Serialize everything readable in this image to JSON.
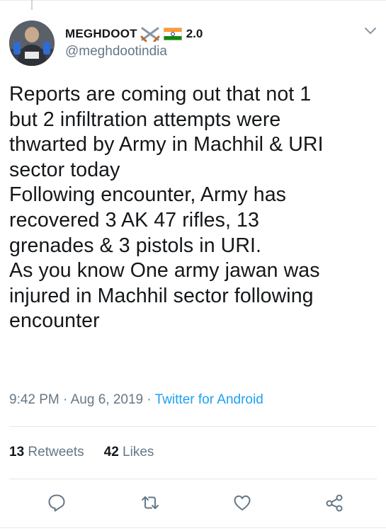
{
  "author": {
    "display_name": "MEGHDOOT",
    "name_suffix": "2.0",
    "handle": "@meghdootindia",
    "name_icons": [
      "crossed-swords-icon",
      "india-flag-icon"
    ]
  },
  "tweet": {
    "lines": [
      "Reports are coming out that not 1",
      "but 2 infiltration attempts were",
      "thwarted by Army in Machhil & URI",
      "sector today",
      "Following encounter, Army has",
      "recovered 3 AK 47 rifles, 13",
      "grenades & 3 pistols in URI.",
      "As you know One army jawan was",
      "injured in Machhil sector following",
      "encounter"
    ]
  },
  "meta": {
    "time": "9:42 PM",
    "separator": " · ",
    "date": "Aug 6, 2019",
    "source": "Twitter for Android"
  },
  "stats": {
    "retweets_count": "13",
    "retweets_label": " Retweets",
    "likes_count": "42",
    "likes_label": " Likes"
  },
  "actions": [
    "reply-icon",
    "retweet-icon",
    "like-icon",
    "share-icon"
  ],
  "colors": {
    "text": "#14171a",
    "secondary": "#657786",
    "link": "#1da1f2",
    "divider": "#e1e8ed"
  }
}
